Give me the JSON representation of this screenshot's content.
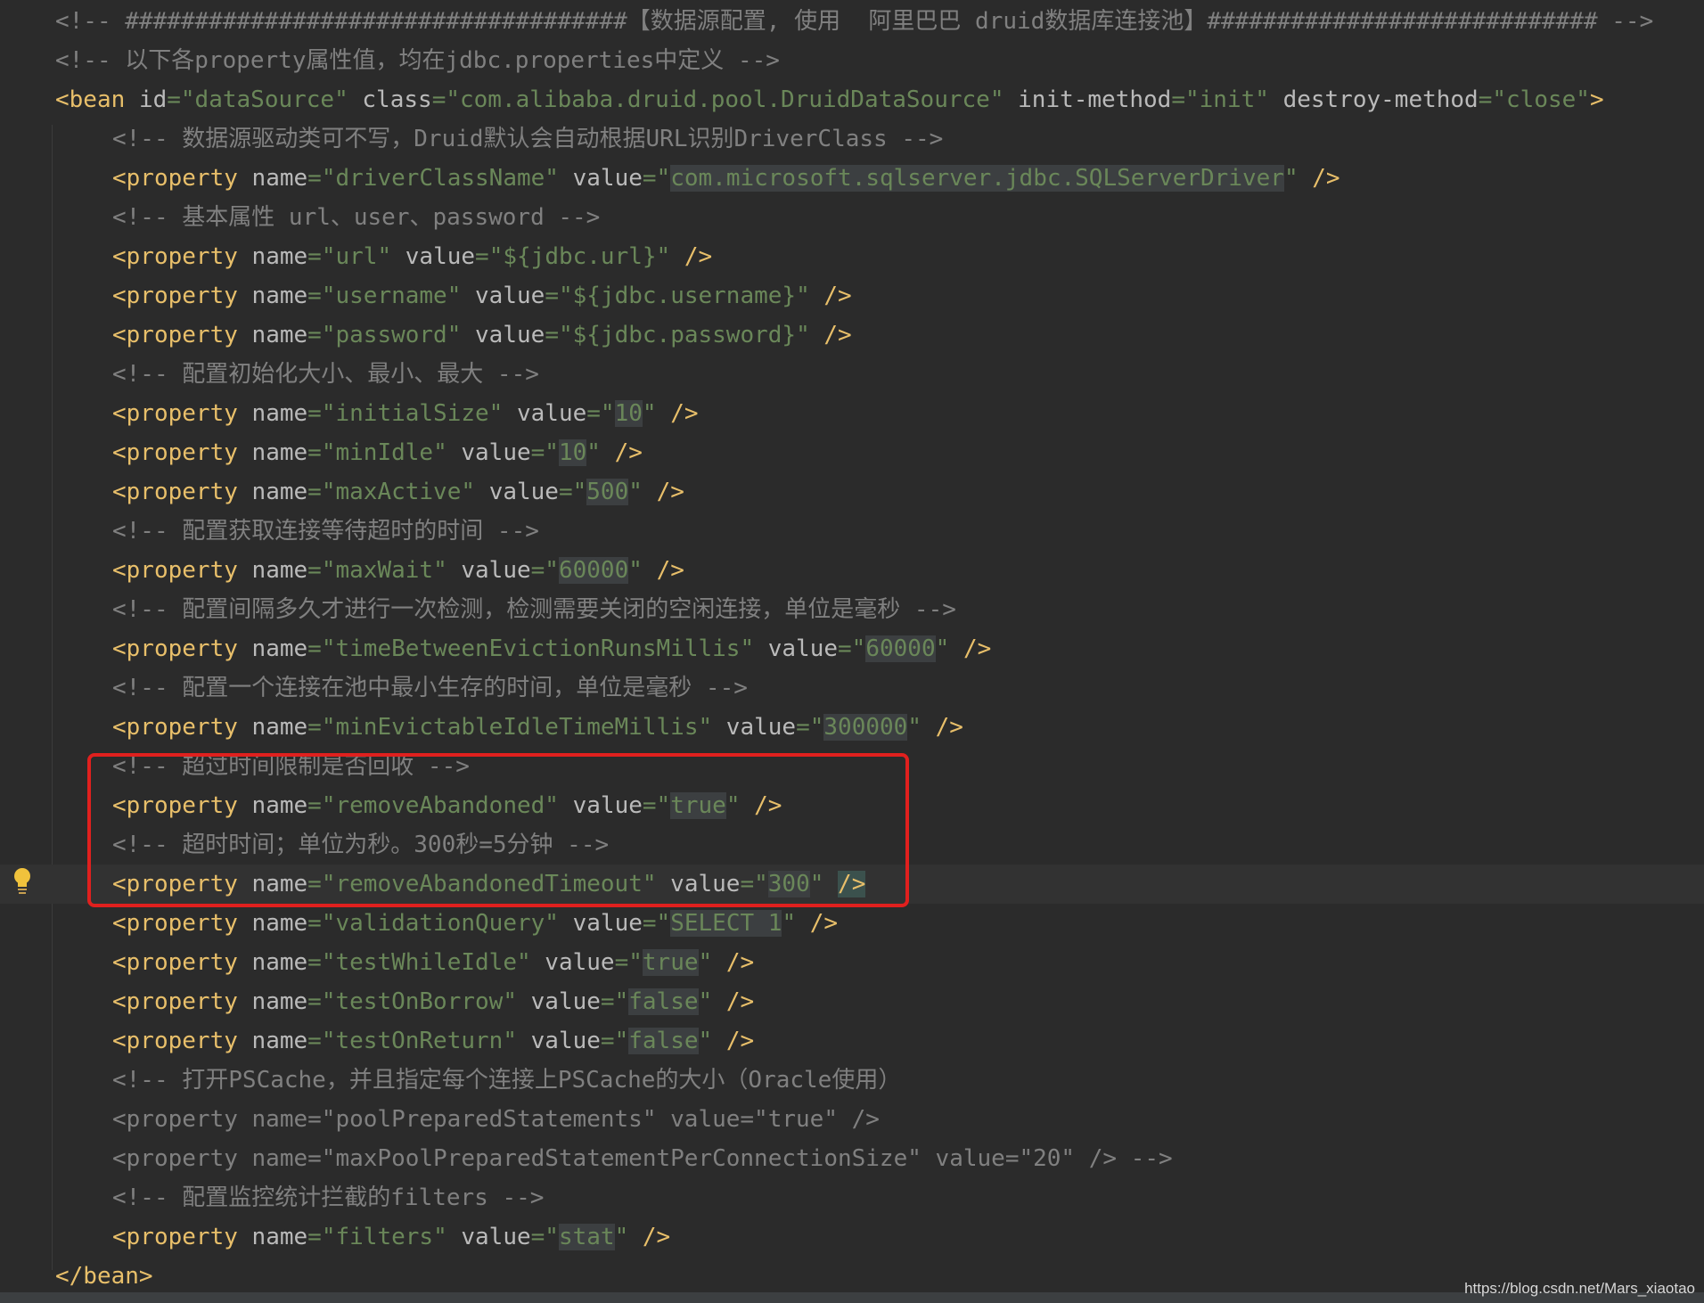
{
  "editor": {
    "lines": [
      {
        "indent": 0,
        "type": "comment",
        "text": "<!-- ####################################【数据源配置, 使用  阿里巴巴 druid数据库连接池】############################ -->"
      },
      {
        "indent": 0,
        "type": "comment",
        "text": "<!-- 以下各property属性值，均在jdbc.properties中定义 -->"
      },
      {
        "indent": 0,
        "type": "bean",
        "tag_open": "<bean",
        "attrs": [
          {
            "name": "id",
            "value": "dataSource"
          },
          {
            "name": "class",
            "value": "com.alibaba.druid.pool.DruidDataSource"
          },
          {
            "name": "init-method",
            "value": "init"
          },
          {
            "name": "destroy-method",
            "value": "close"
          }
        ],
        "close": ">"
      },
      {
        "indent": 1,
        "type": "comment",
        "text": "<!-- 数据源驱动类可不写，Druid默认会自动根据URL识别DriverClass -->"
      },
      {
        "indent": 1,
        "type": "prop",
        "pname": "driverClassName",
        "pvalue": "com.microsoft.sqlserver.jdbc.SQLServerDriver",
        "hl": true
      },
      {
        "indent": 1,
        "type": "comment",
        "text": "<!-- 基本属性 url、user、password -->"
      },
      {
        "indent": 1,
        "type": "prop",
        "pname": "url",
        "pvalue": "${jdbc.url}",
        "hl": false
      },
      {
        "indent": 1,
        "type": "prop",
        "pname": "username",
        "pvalue": "${jdbc.username}",
        "hl": false
      },
      {
        "indent": 1,
        "type": "prop",
        "pname": "password",
        "pvalue": "${jdbc.password}",
        "hl": false
      },
      {
        "indent": 1,
        "type": "comment",
        "text": "<!-- 配置初始化大小、最小、最大 -->"
      },
      {
        "indent": 1,
        "type": "prop",
        "pname": "initialSize",
        "pvalue": "10",
        "hl": true
      },
      {
        "indent": 1,
        "type": "prop",
        "pname": "minIdle",
        "pvalue": "10",
        "hl": true
      },
      {
        "indent": 1,
        "type": "prop",
        "pname": "maxActive",
        "pvalue": "500",
        "hl": true
      },
      {
        "indent": 1,
        "type": "comment",
        "text": "<!-- 配置获取连接等待超时的时间 -->"
      },
      {
        "indent": 1,
        "type": "prop",
        "pname": "maxWait",
        "pvalue": "60000",
        "hl": true
      },
      {
        "indent": 1,
        "type": "comment",
        "text": "<!-- 配置间隔多久才进行一次检测，检测需要关闭的空闲连接，单位是毫秒 -->"
      },
      {
        "indent": 1,
        "type": "prop",
        "pname": "timeBetweenEvictionRunsMillis",
        "pvalue": "60000",
        "hl": true
      },
      {
        "indent": 1,
        "type": "comment",
        "text": "<!-- 配置一个连接在池中最小生存的时间，单位是毫秒 -->"
      },
      {
        "indent": 1,
        "type": "prop",
        "pname": "minEvictableIdleTimeMillis",
        "pvalue": "300000",
        "hl": true
      },
      {
        "indent": 1,
        "type": "comment",
        "text": "<!-- 超过时间限制是否回收 -->"
      },
      {
        "indent": 1,
        "type": "prop",
        "pname": "removeAbandoned",
        "pvalue": "true",
        "hl": true
      },
      {
        "indent": 1,
        "type": "comment",
        "text": "<!-- 超时时间；单位为秒。300秒=5分钟 -->"
      },
      {
        "indent": 1,
        "type": "prop",
        "pname": "removeAbandonedTimeout",
        "pvalue": "300",
        "hl": true,
        "current": true
      },
      {
        "indent": 1,
        "type": "prop",
        "pname": "validationQuery",
        "pvalue": "SELECT 1",
        "hl": true
      },
      {
        "indent": 1,
        "type": "prop",
        "pname": "testWhileIdle",
        "pvalue": "true",
        "hl": true
      },
      {
        "indent": 1,
        "type": "prop",
        "pname": "testOnBorrow",
        "pvalue": "false",
        "hl": true
      },
      {
        "indent": 1,
        "type": "prop",
        "pname": "testOnReturn",
        "pvalue": "false",
        "hl": true
      },
      {
        "indent": 1,
        "type": "comment",
        "text": "<!-- 打开PSCache，并且指定每个连接上PSCache的大小（Oracle使用）"
      },
      {
        "indent": 1,
        "type": "comment",
        "text": "<property name=\"poolPreparedStatements\" value=\"true\" />"
      },
      {
        "indent": 1,
        "type": "comment",
        "text": "<property name=\"maxPoolPreparedStatementPerConnectionSize\" value=\"20\" /> -->"
      },
      {
        "indent": 1,
        "type": "comment",
        "text": "<!-- 配置监控统计拦截的filters -->"
      },
      {
        "indent": 1,
        "type": "prop",
        "pname": "filters",
        "pvalue": "stat",
        "hl": true
      },
      {
        "indent": 0,
        "type": "endtag",
        "text": "</bean>"
      }
    ]
  },
  "syntax": {
    "prop_tag": "<property",
    "name_attr": "name",
    "value_attr": "value",
    "self_close": "/>",
    "quote": "\""
  },
  "colors": {
    "background": "#2b2b2b",
    "tag": "#e8bf6a",
    "attr": "#bababa",
    "string": "#6a8759",
    "comment": "#808080",
    "highlight_box": "#e0201e"
  },
  "icons": {
    "gutter": "lightbulb-icon"
  },
  "watermark": "https://blog.csdn.net/Mars_xiaotao"
}
